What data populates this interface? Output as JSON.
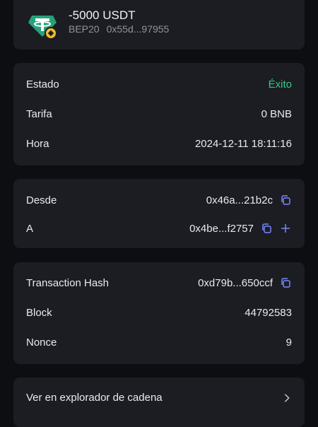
{
  "header": {
    "amount": "-5000 USDT",
    "network": "BEP20",
    "address": "0x55d...97955"
  },
  "status_card": {
    "state_label": "Estado",
    "state_value": "Éxito",
    "fee_label": "Tarifa",
    "fee_value": "0 BNB",
    "time_label": "Hora",
    "time_value": "2024-12-11 18:11:16"
  },
  "addresses_card": {
    "from_label": "Desde",
    "from_value": "0x46a...21b2c",
    "to_label": "A",
    "to_value": "0x4be...f2757"
  },
  "tx_card": {
    "hash_label": "Transaction Hash",
    "hash_value": "0xd79b...650ccf",
    "block_label": "Block",
    "block_value": "44792583",
    "nonce_label": "Nonce",
    "nonce_value": "9"
  },
  "explorer": {
    "label": "Ver en explorador de cadena"
  },
  "colors": {
    "success": "#39c882",
    "icon_accent": "#7d86ff",
    "tether": "#26a17b",
    "bnb": "#f3ba2f"
  },
  "icons": [
    "tether-logo-icon",
    "bnb-badge-icon",
    "copy-icon",
    "add-contact-icon",
    "chevron-right-icon"
  ]
}
